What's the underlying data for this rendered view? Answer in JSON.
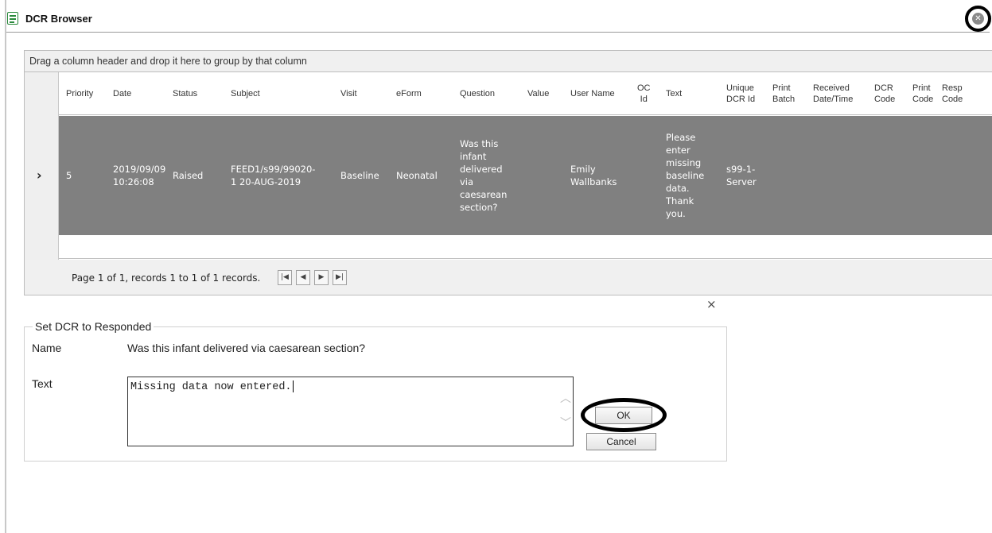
{
  "window": {
    "title": "DCR Browser",
    "close_icon": "close-circle-icon"
  },
  "grid": {
    "group_panel_text": "Drag a column header and drop it here to group by that column",
    "columns": [
      "Priority",
      "Date",
      "Status",
      "Subject",
      "Visit",
      "eForm",
      "Question",
      "Value",
      "User Name",
      "OC\nId",
      "Text",
      "Unique\nDCR Id",
      "Print\nBatch",
      "Received\nDate/Time",
      "DCR\nCode",
      "Print\nCode",
      "Resp\nCode"
    ],
    "rows": [
      {
        "expand_icon": "chevron-right-icon",
        "cells": [
          "5",
          "2019/09/09\n10:26:08",
          "Raised",
          "FEED1/s99/99020-\n1 20-AUG-2019",
          "Baseline",
          "Neonatal",
          "Was this\ninfant\ndelivered\nvia\ncaesarean\nsection?",
          "",
          "Emily\nWallbanks",
          "",
          "Please\nenter\nmissing\nbaseline\ndata.\nThank\nyou.",
          "s99-1-\nServer",
          "",
          "",
          "",
          "",
          ""
        ]
      }
    ],
    "pager": {
      "text": "Page 1 of 1, records 1 to 1 of 1 records.",
      "first": "|◀",
      "prev": "◀",
      "next": "▶",
      "last": "▶|"
    },
    "selected_row_color": "#808080"
  },
  "dialog": {
    "close": "×",
    "legend": "Set DCR to Responded",
    "name_label": "Name",
    "name_value": "Was this infant delivered via caesarean section?",
    "text_label": "Text",
    "text_value": "Missing data now entered.",
    "ok_label": "OK",
    "cancel_label": "Cancel"
  }
}
